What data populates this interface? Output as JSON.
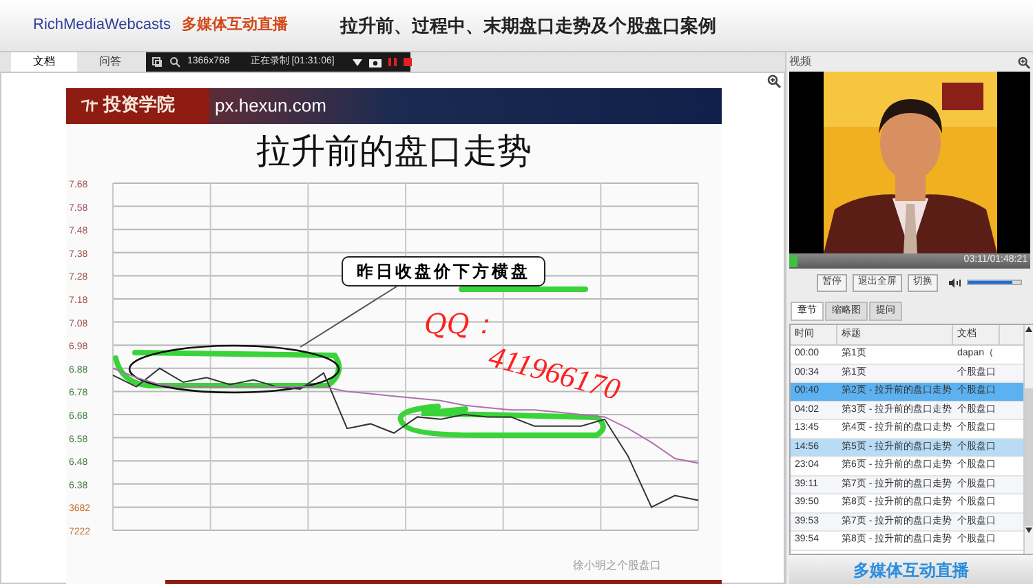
{
  "header": {
    "brand": "RichMediaWebcasts",
    "brand_cn": "多媒体互动直播",
    "title": "拉升前、过程中、末期盘口走势及个股盘口案例"
  },
  "doc_tabs": [
    {
      "label": "文档",
      "selected": true
    },
    {
      "label": "问答",
      "selected": false
    }
  ],
  "recorder": {
    "resolution": "1366x768",
    "status": "正在录制 [01:31:06]"
  },
  "slide": {
    "school": "投资学院",
    "site": "px.hexun.com",
    "title": "拉升前的盘口走势",
    "footer": "徐小明之个股盘口",
    "chart_data": {
      "type": "line",
      "grid": true,
      "series": [
        {
          "color": "#333333",
          "values": [
            6.85,
            6.8,
            6.88,
            6.82,
            6.84,
            6.81,
            6.83,
            6.8,
            6.79,
            6.86,
            6.62,
            6.64,
            6.6,
            6.67,
            6.66,
            6.68,
            6.67,
            6.67,
            6.63,
            6.63,
            6.63,
            6.66,
            6.5,
            6.28,
            6.33,
            6.31
          ]
        },
        {
          "color": "#b070b0",
          "values": [
            6.88,
            6.84,
            6.81,
            6.8,
            6.8,
            6.8,
            6.8,
            6.8,
            6.8,
            6.8,
            6.78,
            6.77,
            6.76,
            6.75,
            6.74,
            6.72,
            6.71,
            6.7,
            6.7,
            6.69,
            6.68,
            6.67,
            6.62,
            6.56,
            6.49,
            6.47
          ]
        }
      ],
      "ylim": [
        6.18,
        7.68
      ],
      "yticks": [
        7.68,
        7.58,
        7.48,
        7.38,
        7.28,
        7.18,
        7.08,
        6.98,
        6.88,
        6.78,
        6.68,
        6.58,
        6.48,
        6.38
      ],
      "annotations": [
        "昨日收盘价下方横盘"
      ]
    },
    "extra_axis_labels": [
      "3682",
      "7222"
    ],
    "overlay": [
      "QQ：",
      "411966170"
    ]
  },
  "video": {
    "label": "视频",
    "time": "03:11/01:48:21",
    "buttons": [
      "暂停",
      "退出全屏",
      "切换"
    ],
    "volume": {
      "level": 0.85
    }
  },
  "side_tabs": [
    {
      "label": "章节",
      "selected": true
    },
    {
      "label": "缩略图",
      "selected": false
    },
    {
      "label": "提问",
      "selected": false
    }
  ],
  "table": {
    "columns": [
      "时间",
      "标题",
      "文档"
    ],
    "rows": [
      {
        "time": "00:00",
        "title": "第1页",
        "doc": "dapan（",
        "selected": false,
        "hovered": false
      },
      {
        "time": "00:34",
        "title": "第1页",
        "doc": "个股盘口",
        "selected": false,
        "hovered": false
      },
      {
        "time": "00:40",
        "title": "第2页 - 拉升前的盘口走势",
        "doc": "个股盘口",
        "selected": true,
        "hovered": false
      },
      {
        "time": "04:02",
        "title": "第3页 - 拉升前的盘口走势",
        "doc": "个股盘口",
        "selected": false,
        "hovered": false
      },
      {
        "time": "13:45",
        "title": "第4页 - 拉升前的盘口走势",
        "doc": "个股盘口",
        "selected": false,
        "hovered": false
      },
      {
        "time": "14:56",
        "title": "第5页 - 拉升前的盘口走势",
        "doc": "个股盘口",
        "selected": false,
        "hovered": true
      },
      {
        "time": "23:04",
        "title": "第6页 - 拉升前的盘口走势",
        "doc": "个股盘口",
        "selected": false,
        "hovered": false
      },
      {
        "time": "39:11",
        "title": "第7页 - 拉升前的盘口走势",
        "doc": "个股盘口",
        "selected": false,
        "hovered": false
      },
      {
        "time": "39:50",
        "title": "第8页 - 拉升前的盘口走势",
        "doc": "个股盘口",
        "selected": false,
        "hovered": false
      },
      {
        "time": "39:53",
        "title": "第7页 - 拉升前的盘口走势",
        "doc": "个股盘口",
        "selected": false,
        "hovered": false
      },
      {
        "time": "39:54",
        "title": "第8页 - 拉升前的盘口走势",
        "doc": "个股盘口",
        "selected": false,
        "hovered": false
      }
    ]
  },
  "footer_logo": "多媒体互动直播"
}
